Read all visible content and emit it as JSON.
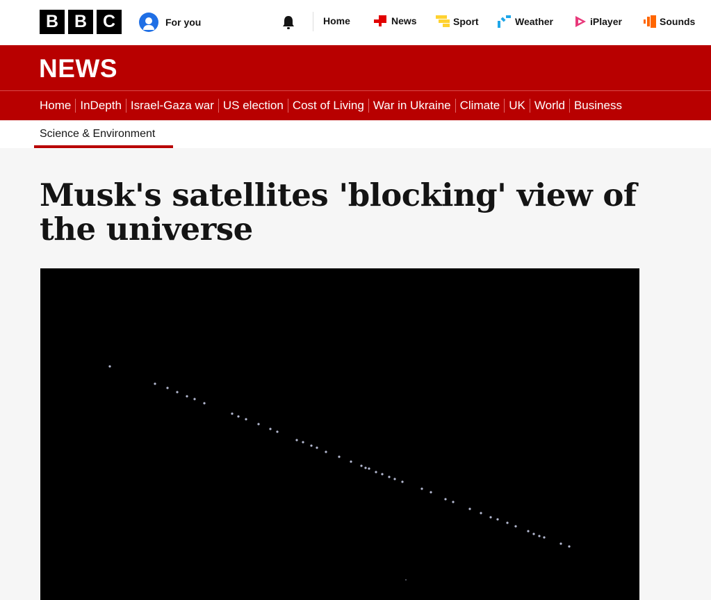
{
  "brand": {
    "logo_letters": [
      "B",
      "B",
      "C"
    ],
    "for_you_label": "For you"
  },
  "top_nav": [
    {
      "label": "Home",
      "icon": "none"
    },
    {
      "label": "News",
      "icon": "news-icon",
      "color": "#e10000"
    },
    {
      "label": "Sport",
      "icon": "sport-icon",
      "color": "#ffd230"
    },
    {
      "label": "Weather",
      "icon": "weather-icon",
      "color": "#1fa6e8"
    },
    {
      "label": "iPlayer",
      "icon": "iplayer-icon",
      "color": "#e8387a"
    },
    {
      "label": "Sounds",
      "icon": "sounds-icon",
      "color": "#ff6600"
    }
  ],
  "news_banner": {
    "title": "NEWS",
    "color": "#b80000"
  },
  "sub_nav": [
    "Home",
    "InDepth",
    "Israel-Gaza war",
    "US election",
    "Cost of Living",
    "War in Ukraine",
    "Climate",
    "UK",
    "World",
    "Business"
  ],
  "section": {
    "label": "Science & Environment"
  },
  "article": {
    "headline": "Musk's satellites 'blocking' view of the universe",
    "image_icon": "satellite-train-night-sky"
  }
}
